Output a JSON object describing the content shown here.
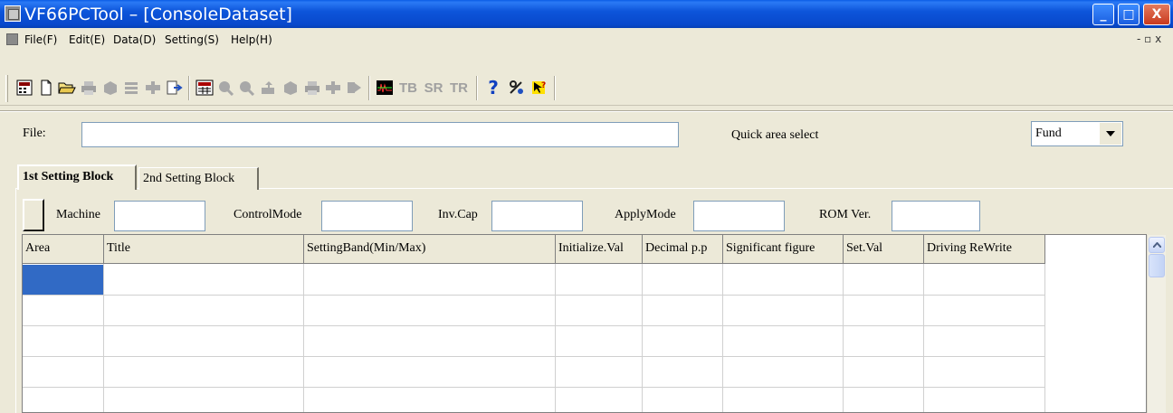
{
  "window": {
    "title": "VF66PCTool – [ConsoleDataset]"
  },
  "window_controls": {
    "minimize": "_",
    "maximize": "□",
    "close": "X"
  },
  "menu": {
    "items": [
      "File(F)",
      "Edit(E)",
      "Data(D)",
      "Setting(S)",
      "Help(H)"
    ],
    "mdi_controls": "- ▫ x"
  },
  "toolbar": {
    "icons": [
      "calculator-icon",
      "new-file-icon",
      "open-folder-icon",
      "print-icon",
      "save-icon",
      "cut-icon",
      "copy-icon",
      "paste-icon",
      "register-icon",
      "search-icon",
      "search-icon",
      "upload-icon",
      "download-icon",
      "print-icon",
      "copy-icon",
      "transfer-icon",
      "waveform-icon"
    ],
    "text_buttons": [
      "TB",
      "SR",
      "TR"
    ],
    "help_glyph": "?"
  },
  "file_row": {
    "label": "File:",
    "value": "",
    "quick_label": "Quick area select",
    "area_select_value": "Fund"
  },
  "tabs": [
    {
      "label": "1st Setting Block",
      "active": true
    },
    {
      "label": "2nd Setting Block",
      "active": false
    }
  ],
  "info": {
    "machine_label": "Machine",
    "controlmode_label": "ControlMode",
    "invcap_label": "Inv.Cap",
    "applymode_label": "ApplyMode",
    "romver_label": "ROM Ver."
  },
  "grid": {
    "columns": [
      "Area",
      "Title",
      "SettingBand(Min/Max)",
      "Initialize.Val",
      "Decimal p.p",
      "Significant figure",
      "Set.Val",
      "Driving ReWrite"
    ]
  },
  "colors": {
    "title_bar": "#0a5ce6",
    "selection": "#316ac5",
    "face": "#ece9d8"
  }
}
